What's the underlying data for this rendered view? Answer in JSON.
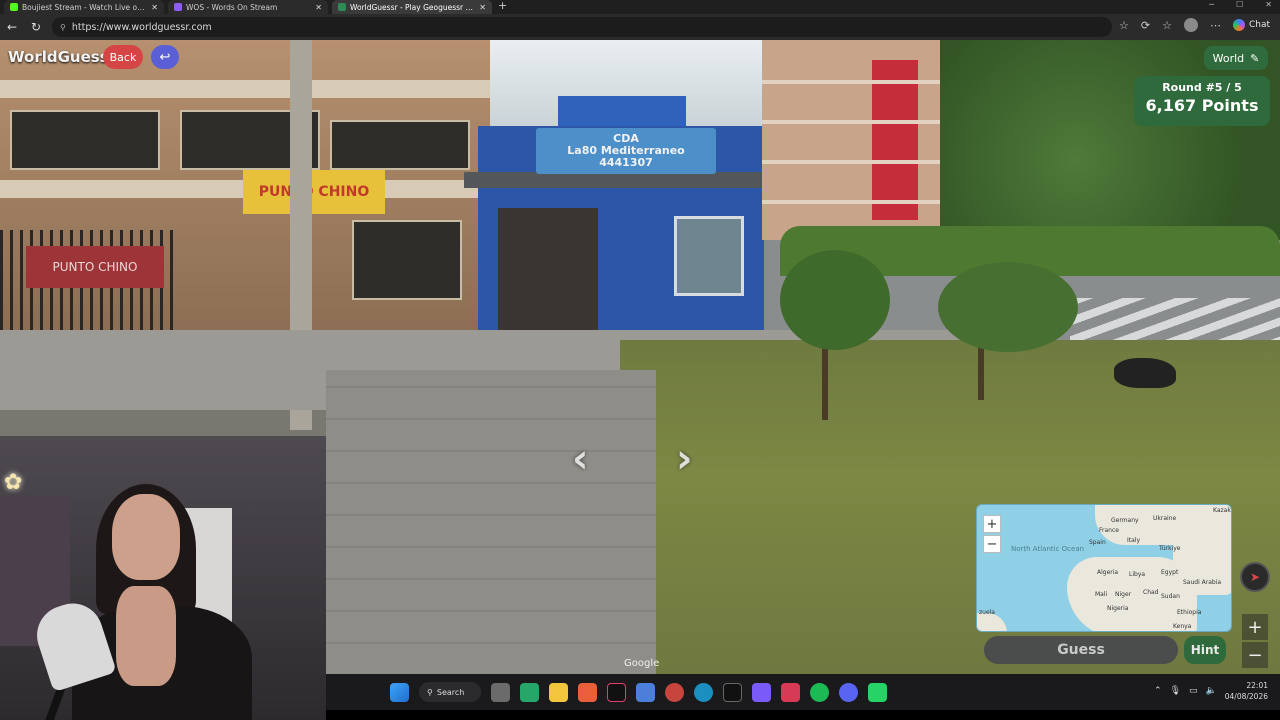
{
  "browser": {
    "tabs": [
      {
        "title": "Boujiest Stream - Watch Live on K",
        "color": "#53fc18",
        "active": false
      },
      {
        "title": "WOS - Words On Stream",
        "color": "#8f5cf5",
        "active": false
      },
      {
        "title": "WorldGuessr - Play Geoguessr for",
        "color": "#2e8b57",
        "active": true
      }
    ],
    "new_tab": "+",
    "url": "https://www.worldguessr.com",
    "chat_label": "Chat"
  },
  "game": {
    "brand": "WorldGuessr",
    "back_label": "Back",
    "mode_label": "World",
    "round_label": "Round #5 / 5",
    "points_label": "6,167 Points",
    "guess_label": "Guess",
    "hint_label": "Hint",
    "google_watermark": "Google"
  },
  "scene": {
    "store_sign": "CDA\nLa80 Mediterraneo\n4441307",
    "restaurant_sign": "PUNTO CHINO",
    "fence_sign": "PUNTO CHINO"
  },
  "minimap": {
    "ocean": "North\nAtlantic\nOcean",
    "labels": [
      "Germany",
      "Ukraine",
      "Kazak",
      "France",
      "Spain",
      "Italy",
      "Türkiye",
      "Algeria",
      "Libya",
      "Egypt",
      "Saudi Arabia",
      "Mali",
      "Niger",
      "Chad",
      "Sudan",
      "Nigeria",
      "Ethiopia",
      "Kenya",
      "zuela"
    ]
  },
  "taskbar": {
    "search_label": "Search",
    "time": "22:01",
    "date": "04/08/2026"
  }
}
